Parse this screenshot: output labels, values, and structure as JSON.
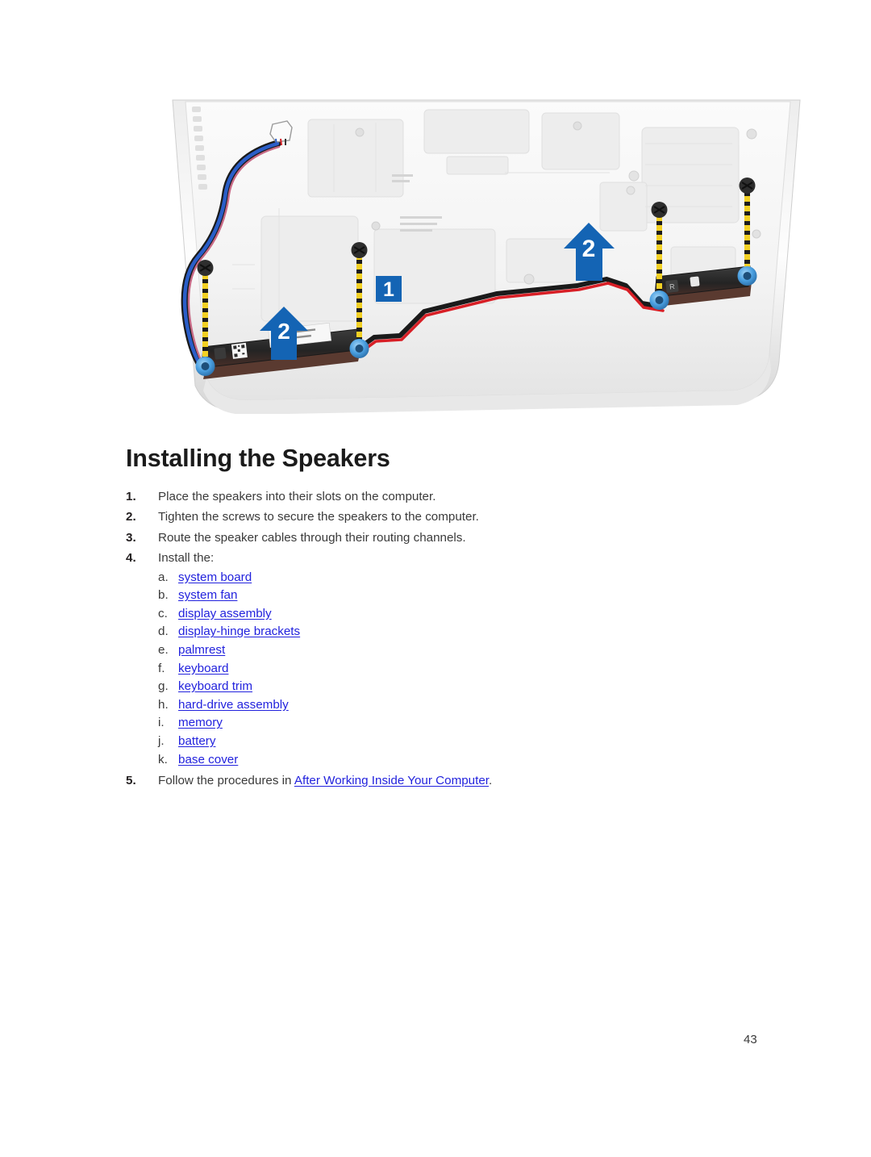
{
  "page": {
    "title": "Installing the Speakers",
    "number": "43"
  },
  "figure": {
    "name": "speaker-installation-diagram",
    "alt": "Laptop base chassis with two speakers, routing cables and screw callouts",
    "callouts": [
      {
        "id": "callout-1",
        "label": "1",
        "shape": "square-badge"
      },
      {
        "id": "callout-2-left",
        "label": "2",
        "shape": "up-arrow"
      },
      {
        "id": "callout-2-right",
        "label": "2",
        "shape": "up-arrow"
      }
    ],
    "colors": {
      "callout_blue": "#1464b4",
      "chassis_light": "#f2f2f2",
      "chassis_shadow": "#d9d9d9",
      "speaker_body": "#2b2b2b",
      "cable_red": "#d81f26",
      "cable_blue": "#2a5ec8",
      "cable_black": "#1a1a1a",
      "screw_yellow": "#f2d024",
      "screw_head": "#2e2e2e",
      "screw_target": "#4a9fe0"
    },
    "speaker_label_right": "R"
  },
  "steps": [
    {
      "num": "1.",
      "text": "Place the speakers into their slots on the computer."
    },
    {
      "num": "2.",
      "text": "Tighten the screws to secure the speakers to the computer."
    },
    {
      "num": "3.",
      "text": "Route the speaker cables through their routing channels."
    },
    {
      "num": "4.",
      "text": "Install the:"
    }
  ],
  "install_items": [
    {
      "letter": "a.",
      "label": "system board"
    },
    {
      "letter": "b.",
      "label": "system fan"
    },
    {
      "letter": "c.",
      "label": "display assembly"
    },
    {
      "letter": "d.",
      "label": "display-hinge brackets"
    },
    {
      "letter": "e.",
      "label": "palmrest"
    },
    {
      "letter": "f.",
      "label": "keyboard"
    },
    {
      "letter": "g.",
      "label": "keyboard trim"
    },
    {
      "letter": "h.",
      "label": "hard-drive assembly"
    },
    {
      "letter": "i.",
      "label": "memory"
    },
    {
      "letter": "j.",
      "label": "battery"
    },
    {
      "letter": "k.",
      "label": "base cover"
    }
  ],
  "final_step": {
    "num": "5.",
    "prefix": "Follow the procedures in ",
    "link": "After Working Inside Your Computer",
    "suffix": "."
  }
}
